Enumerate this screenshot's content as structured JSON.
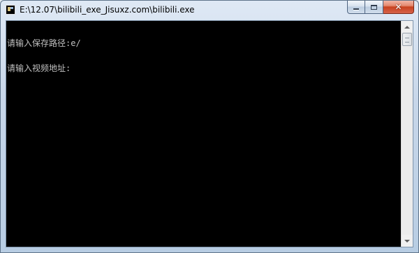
{
  "window": {
    "title": "E:\\12.07\\bilibili_exe_Jisuxz.com\\bilibili.exe",
    "icon": "console-app-icon",
    "caption_buttons": {
      "minimize_icon": "minimize-icon",
      "maximize_icon": "maximize-icon",
      "close_glyph": "✕"
    }
  },
  "console": {
    "lines": [
      "请输入保存路径:e/",
      "请输入视频地址:"
    ],
    "text_color": "#c0c0c0",
    "background_color": "#000000"
  },
  "scrollbar": {
    "up_icon": "scroll-up-arrow-icon",
    "down_icon": "scroll-down-arrow-icon"
  }
}
